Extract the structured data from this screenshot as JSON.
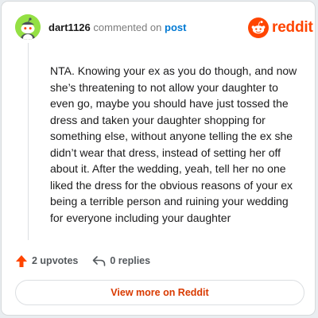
{
  "comment": {
    "username": "dart1126",
    "action_text": "commented on",
    "post_link": "post",
    "body": "NTA. Knowing your ex as you do though, and now she’s threatening to not allow your daughter to even go, maybe you should have just tossed the dress and taken your daughter shopping for something else, without anyone telling the ex she didn’t wear that dress, instead of setting her off about it. After the wedding, yeah, tell her no one liked the dress for the obvious reasons of your ex being a terrible person and ruining your wedding for everyone including your daughter",
    "avatar_icon": "snoo-avatar-icon",
    "avatar_color": "#94e044"
  },
  "brand": {
    "logo_text": "reddit",
    "logo_icon": "reddit-logo-icon",
    "color": "#ff4500"
  },
  "actions": {
    "upvotes_label": "2 upvotes",
    "upvote_icon": "upvote-arrow-icon",
    "upvote_color": "#ff4500",
    "replies_label": "0 replies",
    "reply_icon": "reply-arrow-icon"
  },
  "footer": {
    "view_more_label": "View more on Reddit",
    "link_color": "#d93a00"
  }
}
